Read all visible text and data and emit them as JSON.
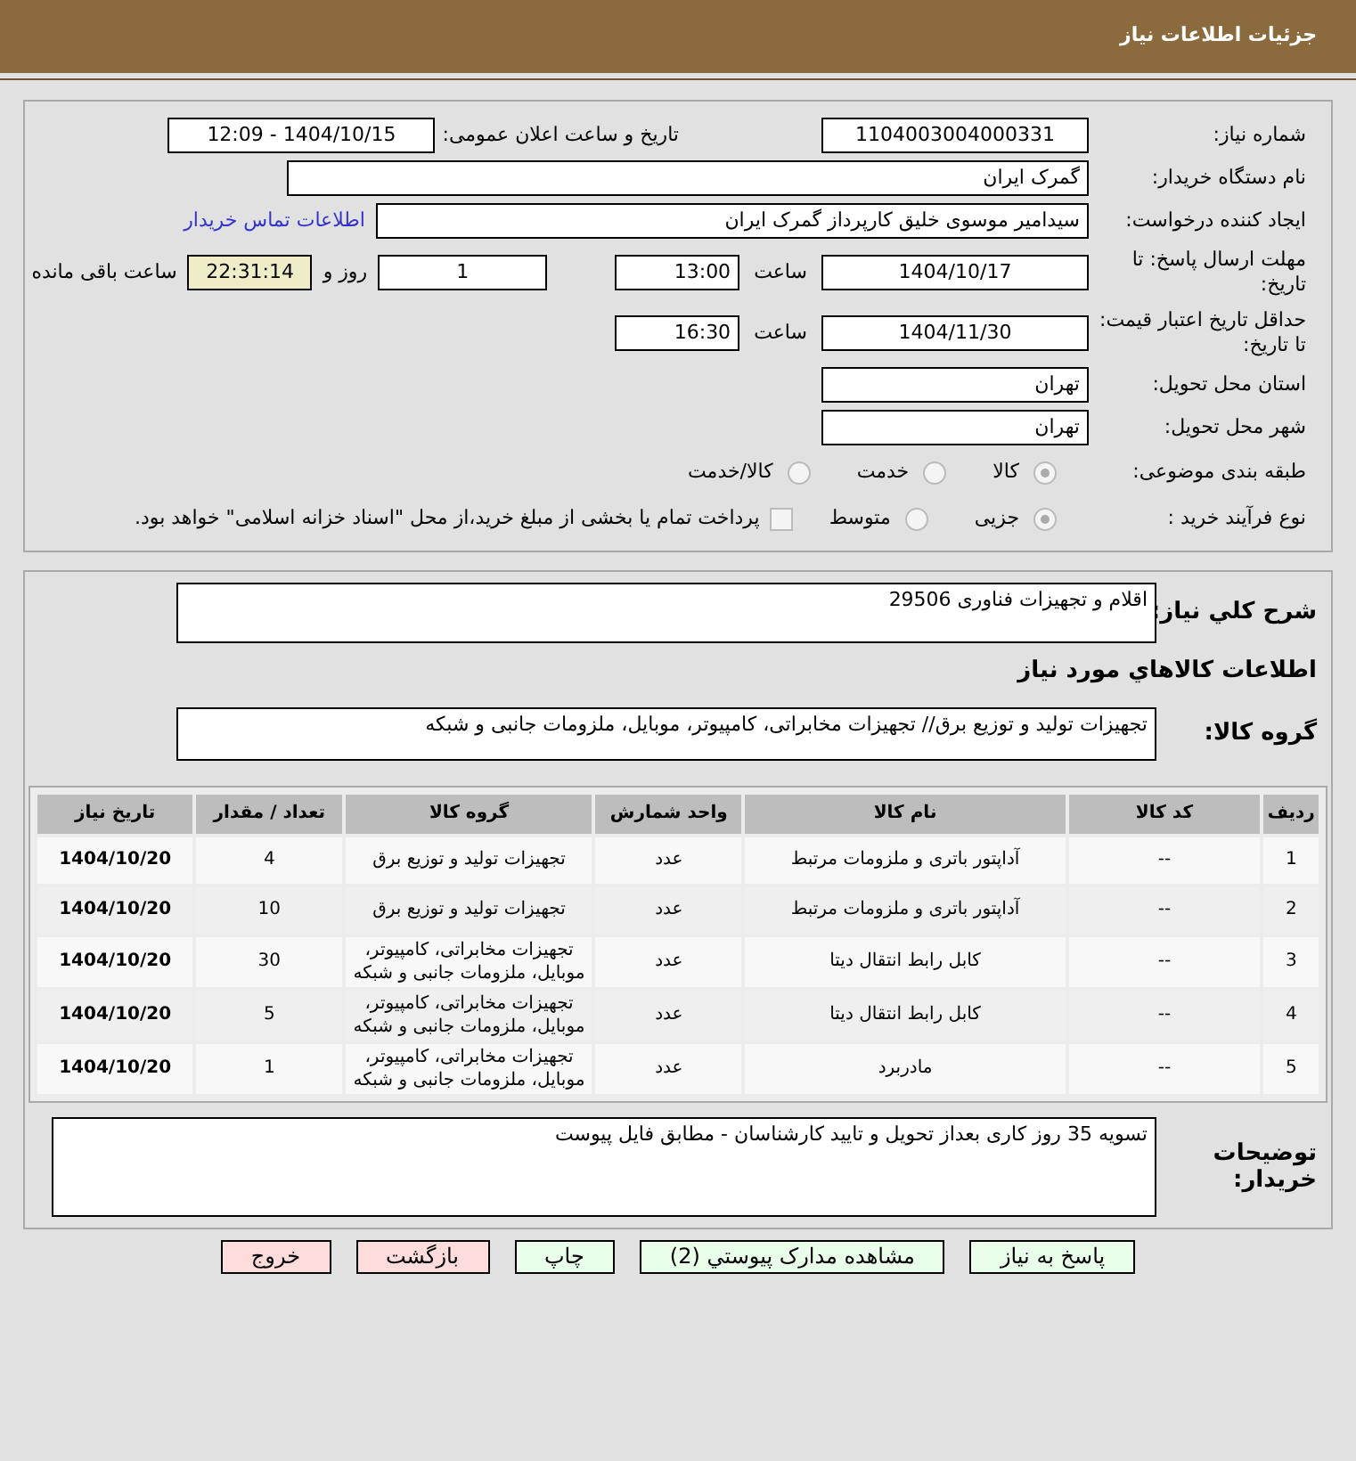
{
  "header": {
    "title": "جزئیات اطلاعات نیاز"
  },
  "need_number": {
    "label": "شماره نیاز:",
    "value": "1104003004000331"
  },
  "announce": {
    "label": "تاریخ و ساعت اعلان عمومی:",
    "value": "1404/10/15 - 12:09"
  },
  "buyer": {
    "label": "نام دستگاه خریدار:",
    "value": "گمرک ایران"
  },
  "creator": {
    "label": "ایجاد کننده درخواست:",
    "value": "سیدامیر موسوی خلیق کارپرداز گمرک ایران",
    "link": "اطلاعات تماس خریدار"
  },
  "deadline": {
    "label": "مهلت ارسال پاسخ: تا تاریخ:",
    "date": "1404/10/17",
    "time_label": "ساعت",
    "time": "13:00",
    "days": "1",
    "days_label": "روز و",
    "remaining": "22:31:14",
    "remaining_label": "ساعت باقی مانده"
  },
  "validity": {
    "label": "حداقل تاریخ اعتبار قیمت: تا تاریخ:",
    "date": "1404/11/30",
    "time_label": "ساعت",
    "time": "16:30"
  },
  "province": {
    "label": "استان محل تحویل:",
    "value": "تهران"
  },
  "city": {
    "label": "شهر محل تحویل:",
    "value": "تهران"
  },
  "category": {
    "label": "طبقه بندی موضوعی:",
    "options": [
      {
        "label": "کالا",
        "selected": true
      },
      {
        "label": "خدمت",
        "selected": false
      },
      {
        "label": "کالا/خدمت",
        "selected": false
      }
    ]
  },
  "purchase_type": {
    "label": "نوع فرآیند خرید :",
    "options": [
      {
        "label": "جزیی",
        "selected": true
      },
      {
        "label": "متوسط",
        "selected": false
      }
    ],
    "treasury": {
      "label": "پرداخت تمام یا بخشی از مبلغ خرید،از محل \"اسناد خزانه اسلامی\" خواهد بود.",
      "checked": false
    }
  },
  "description": {
    "label": "شرح کلي نیاز:",
    "value": "اقلام و تجهیزات فناوری 29506"
  },
  "goods_title": "اطلاعات کالاهاي مورد نیاز",
  "goods_group": {
    "label": "گروه کالا:",
    "value": "تجهیزات تولید و توزیع برق// تجهیزات مخابراتی، کامپیوتر، موبایل، ملزومات جانبی و شبکه"
  },
  "table": {
    "columns": [
      "ردیف",
      "کد کالا",
      "نام کالا",
      "واحد شمارش",
      "گروه کالا",
      "تعداد / مقدار",
      "تاریخ نیاز"
    ],
    "rows": [
      [
        "1",
        "--",
        "آداپتور باتری و ملزومات مرتبط",
        "عدد",
        "تجهیزات تولید و توزیع برق",
        "4",
        "1404/10/20"
      ],
      [
        "2",
        "--",
        "آداپتور باتری و ملزومات مرتبط",
        "عدد",
        "تجهیزات تولید و توزیع برق",
        "10",
        "1404/10/20"
      ],
      [
        "3",
        "--",
        "کابل رابط انتقال دیتا",
        "عدد",
        "تجهیزات مخابراتی، کامپیوتر، موبایل، ملزومات جانبی و شبکه",
        "30",
        "1404/10/20"
      ],
      [
        "4",
        "--",
        "کابل رابط انتقال دیتا",
        "عدد",
        "تجهیزات مخابراتی، کامپیوتر، موبایل، ملزومات جانبی و شبکه",
        "5",
        "1404/10/20"
      ],
      [
        "5",
        "--",
        "مادربرد",
        "عدد",
        "تجهیزات مخابراتی، کامپیوتر، موبایل، ملزومات جانبی و شبکه",
        "1",
        "1404/10/20"
      ]
    ]
  },
  "notes": {
    "label": "توضیحات خریدار:",
    "value": "تسویه 35 روز کاری بعداز تحویل و تایید کارشناسان - مطابق فایل پیوست"
  },
  "buttons": [
    {
      "label": "پاسخ به نیاز",
      "kind": "primary"
    },
    {
      "label": "مشاهده مدارک پیوستي (2)",
      "kind": "primary"
    },
    {
      "label": "چاپ",
      "kind": "primary"
    },
    {
      "label": "بازگشت",
      "kind": "danger"
    },
    {
      "label": "خروج",
      "kind": "danger"
    }
  ]
}
